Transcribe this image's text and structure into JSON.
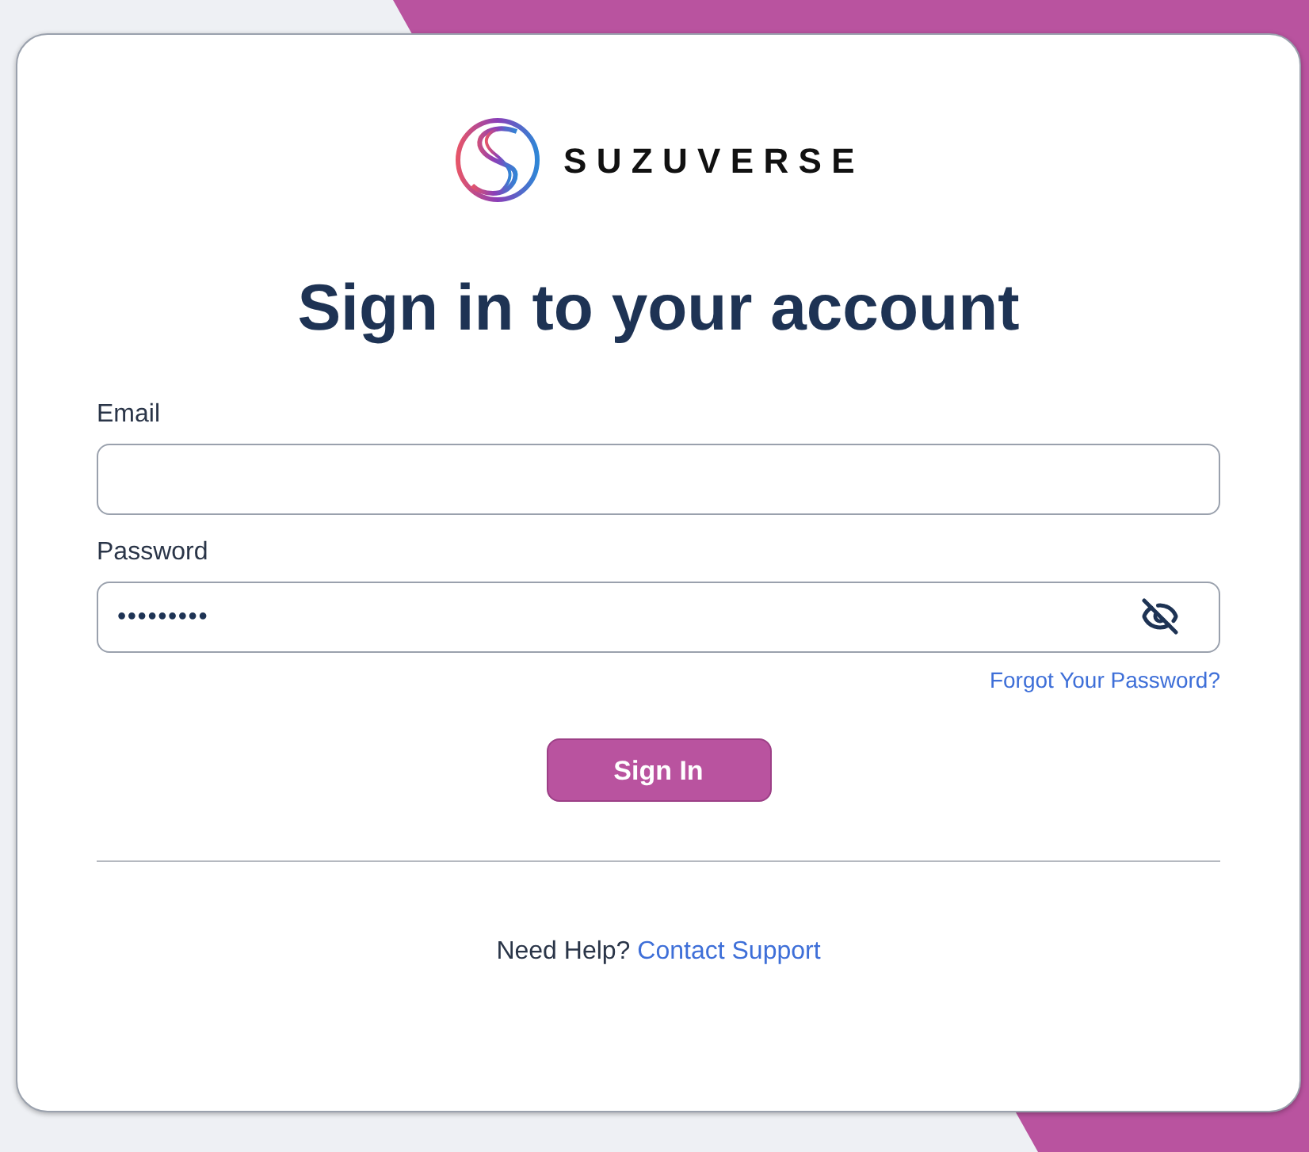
{
  "brand": {
    "name": "SUZUVERSE"
  },
  "title": "Sign in to your account",
  "fields": [
    {
      "kind": "email",
      "label": "Email"
    },
    {
      "kind": "password",
      "label": "Password",
      "value": "•••••••••",
      "revealed": false
    }
  ],
  "forgot_link": "Forgot Your Password?",
  "submit_button": "Sign In",
  "help": {
    "text": "Need Help?",
    "link": "Contact Support"
  }
}
